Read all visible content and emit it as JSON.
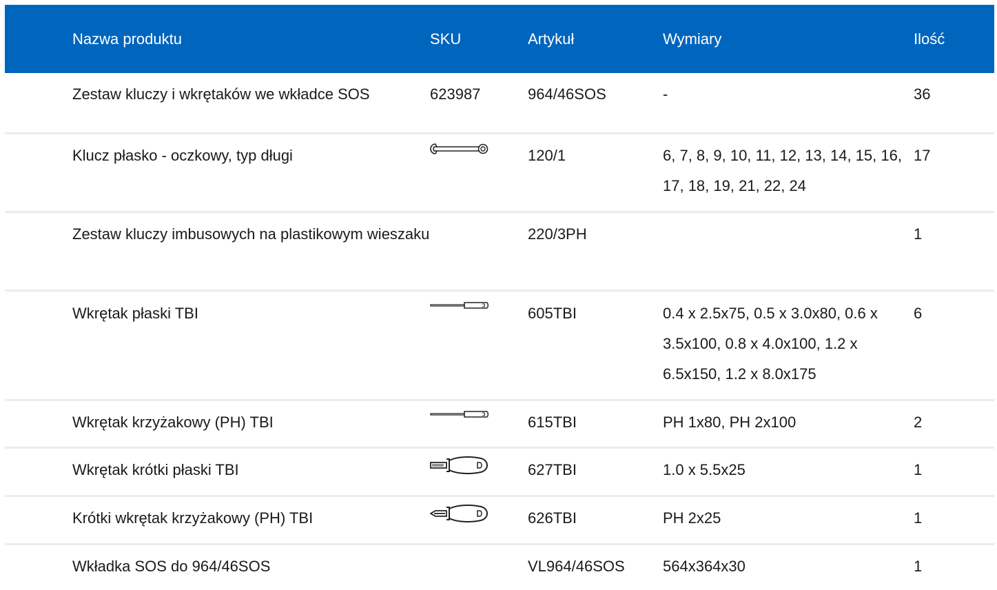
{
  "header": {
    "name": "Nazwa produktu",
    "sku": "SKU",
    "article": "Artykuł",
    "dimensions": "Wymiary",
    "quantity": "Ilość"
  },
  "rows": [
    {
      "name": "Zestaw kluczy i wkrętaków we wkładce SOS",
      "sku": "623987",
      "sku_icon": "",
      "article": "964/46SOS",
      "dimensions": "-",
      "quantity": "36"
    },
    {
      "name": "Klucz płasko - oczkowy, typ długi",
      "sku": "",
      "sku_icon": "combination-wrench-icon",
      "article": "120/1",
      "dimensions": "6, 7, 8, 9, 10, 11, 12, 13, 14, 15, 16, 17, 18, 19, 21, 22, 24",
      "quantity": "17"
    },
    {
      "name": "Zestaw kluczy imbusowych na plastikowym wieszaku",
      "sku": "",
      "sku_icon": "",
      "article": "220/3PH",
      "dimensions": "",
      "quantity": "1"
    },
    {
      "name": "Wkrętak płaski TBI",
      "sku": "",
      "sku_icon": "flat-screwdriver-icon",
      "article": "605TBI",
      "dimensions": "0.4 x 2.5x75, 0.5 x 3.0x80, 0.6 x 3.5x100, 0.8 x 4.0x100, 1.2 x 6.5x150, 1.2 x 8.0x175",
      "quantity": "6"
    },
    {
      "name": "Wkrętak krzyżakowy (PH) TBI",
      "sku": "",
      "sku_icon": "phillips-screwdriver-icon",
      "article": "615TBI",
      "dimensions": "PH 1x80, PH 2x100",
      "quantity": "2"
    },
    {
      "name": "Wkrętak krótki płaski TBI",
      "sku": "",
      "sku_icon": "short-flat-screwdriver-icon",
      "article": "627TBI",
      "dimensions": "1.0 x 5.5x25",
      "quantity": "1"
    },
    {
      "name": "Krótki wkrętak krzyżakowy (PH) TBI",
      "sku": "",
      "sku_icon": "short-phillips-screwdriver-icon",
      "article": "626TBI",
      "dimensions": "PH 2x25",
      "quantity": "1"
    },
    {
      "name": "Wkładka SOS do 964/46SOS",
      "sku": "",
      "sku_icon": "",
      "article": "VL964/46SOS",
      "dimensions": "564x364x30",
      "quantity": "1"
    }
  ],
  "colors": {
    "header_bg": "#0065bd",
    "header_text": "#ffffff",
    "row_divider": "#ececec"
  }
}
